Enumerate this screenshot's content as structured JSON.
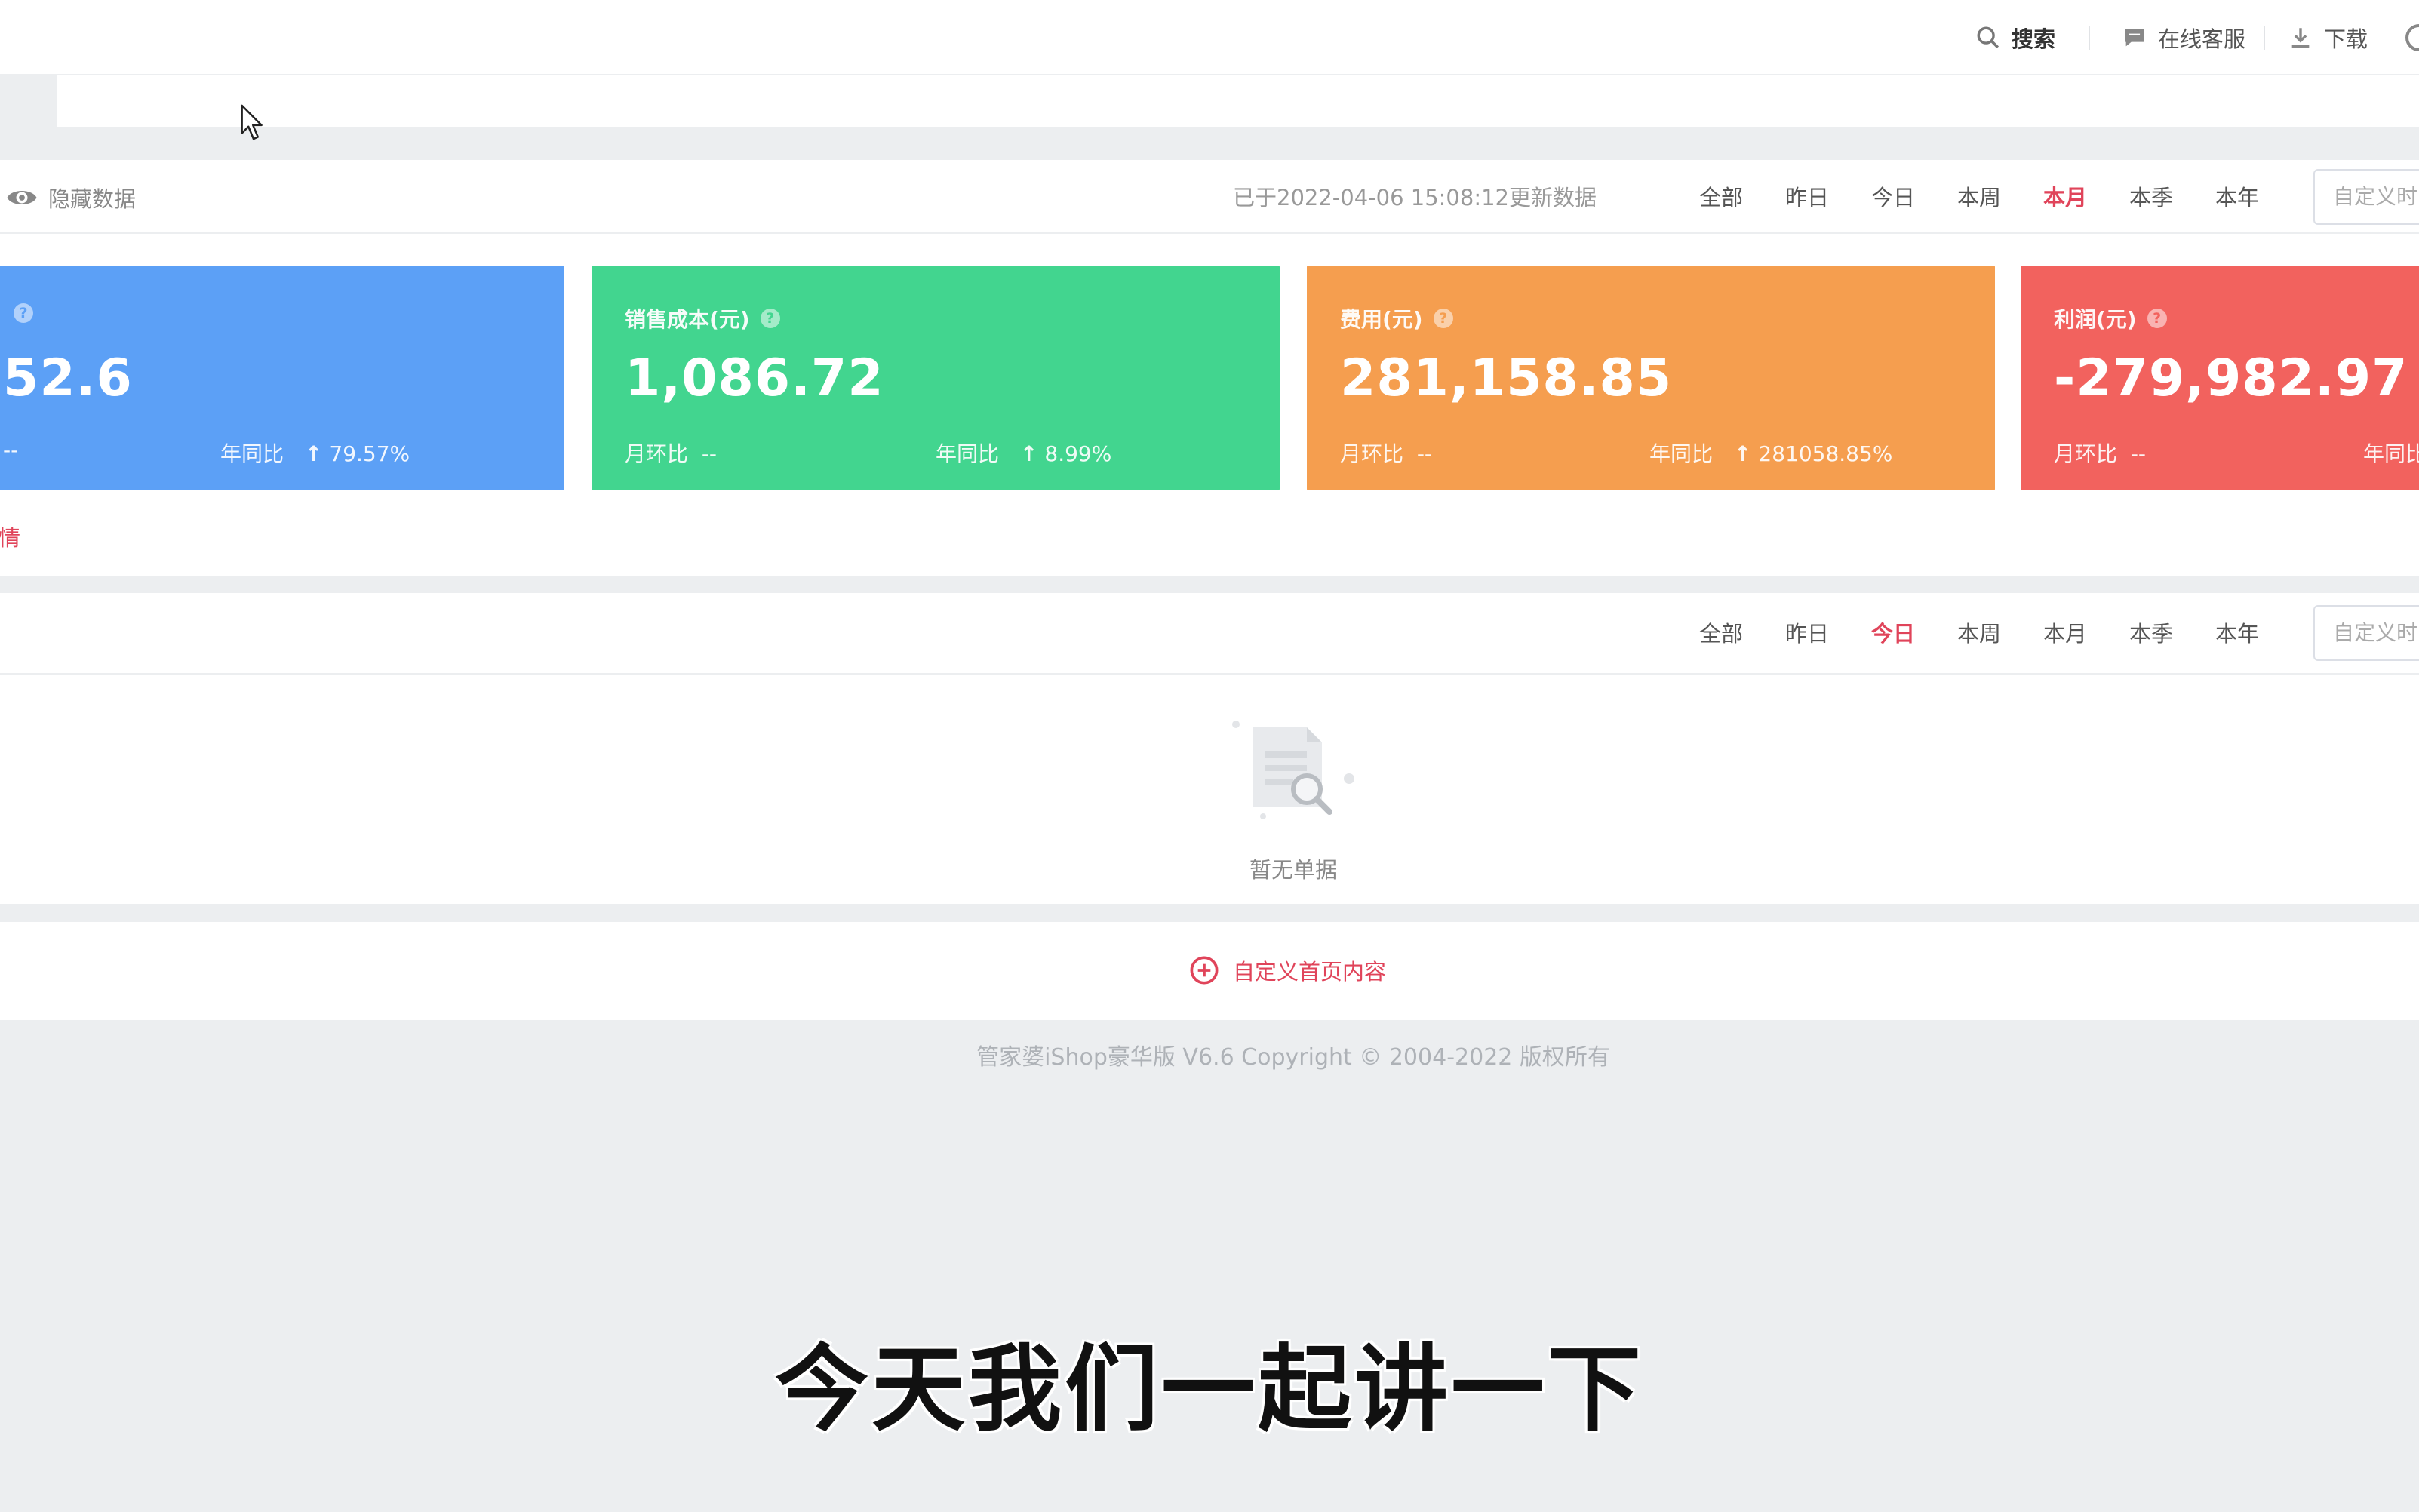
{
  "topbar": {
    "search_label": "搜索",
    "service_label": "在线客服",
    "download_label": "下载"
  },
  "toolbar": {
    "hide_data_label": "隐藏数据",
    "updated_text": "已于2022-04-06 15:08:12更新数据"
  },
  "filters": [
    "全部",
    "昨日",
    "今日",
    "本周",
    "本月",
    "本季",
    "本年"
  ],
  "panel1_active_filter": "本月",
  "panel2_active_filter": "今日",
  "date_range_placeholder": "自定义时",
  "cards": [
    {
      "title": "",
      "value": "52.6",
      "mom_label": "",
      "mom_value": "--",
      "yoy_label": "年同比",
      "yoy_value": "79.57%",
      "color": "#5ca0f6"
    },
    {
      "title": "销售成本(元)",
      "value": "1,086.72",
      "mom_label": "月环比",
      "mom_value": "--",
      "yoy_label": "年同比",
      "yoy_value": "8.99%",
      "color": "#42d58f"
    },
    {
      "title": "费用(元)",
      "value": "281,158.85",
      "mom_label": "月环比",
      "mom_value": "--",
      "yoy_label": "年同比",
      "yoy_value": "281058.85%",
      "color": "#f59e4f"
    },
    {
      "title": "利润(元)",
      "value": "-279,982.97",
      "mom_label": "月环比",
      "mom_value": "--",
      "yoy_label": "年同比",
      "yoy_value": "",
      "color": "#f2625e"
    }
  ],
  "details_link_fragment": "情",
  "empty_state_text": "暂无单据",
  "custom_home_label": "自定义首页内容",
  "copyright": "管家婆iShop豪华版 V6.6 Copyright © 2004-2022 版权所有",
  "subtitle": "今天我们一起讲一下",
  "colors": {
    "accent": "#e0445a",
    "blue": "#5ca0f6",
    "green": "#42d58f",
    "orange": "#f59e4f",
    "red": "#f2625e"
  }
}
